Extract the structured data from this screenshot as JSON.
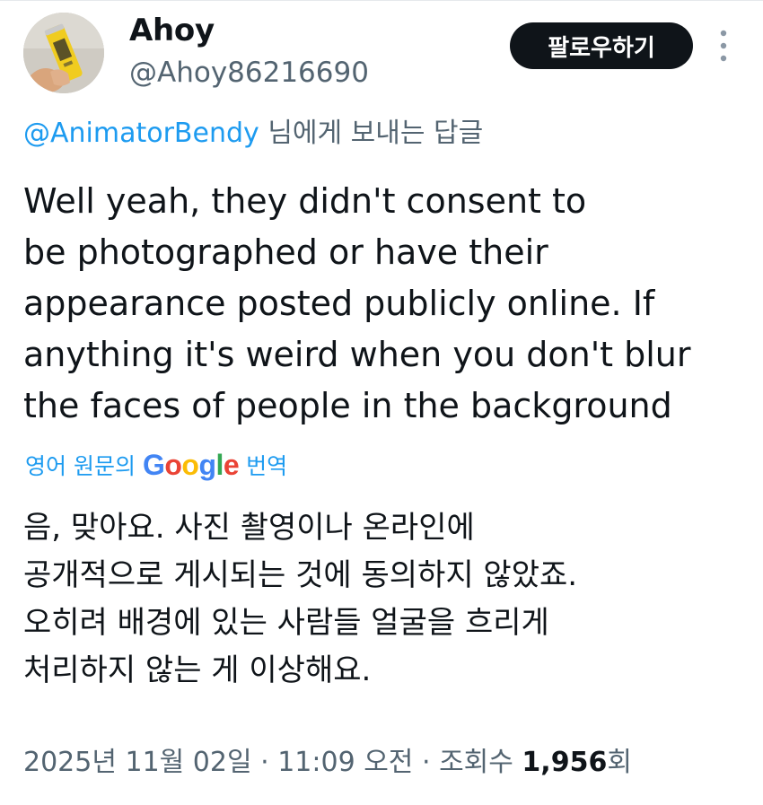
{
  "author": {
    "display_name": "Ahoy",
    "handle": "@Ahoy86216690",
    "avatar_icon": "can-in-hand-photo"
  },
  "actions": {
    "follow_label": "팔로우하기",
    "more_icon": "more-vertical-icon"
  },
  "reply": {
    "mention": "@AnimatorBendy",
    "suffix": " 님에게 보내는 답글"
  },
  "tweet": {
    "lines": [
      "Well yeah, they didn't consent to",
      "be photographed or have their",
      "appearance posted publicly online. If",
      "anything it's weird when you don't blur",
      "the faces of people in the background"
    ]
  },
  "translation": {
    "label_prefix": "영어 원문의",
    "google_letters": [
      "G",
      "o",
      "o",
      "g",
      "l",
      "e"
    ],
    "label_suffix": "번역",
    "lines": [
      "음, 맞아요. 사진 촬영이나 온라인에",
      "공개적으로 게시되는 것에 동의하지 않았죠.",
      "오히려 배경에 있는 사람들 얼굴을 흐리게",
      "처리하지 않는 게 이상해요."
    ]
  },
  "meta": {
    "date": "2025년 11월 02일",
    "separator": "·",
    "time": "11:09 오전",
    "views_label": "조회수",
    "views_count": "1,956",
    "views_unit": "회"
  },
  "colors": {
    "link_blue": "#1d9bf0",
    "secondary_text": "#536471",
    "primary_text": "#0f1419",
    "button_bg": "#0f1419"
  }
}
